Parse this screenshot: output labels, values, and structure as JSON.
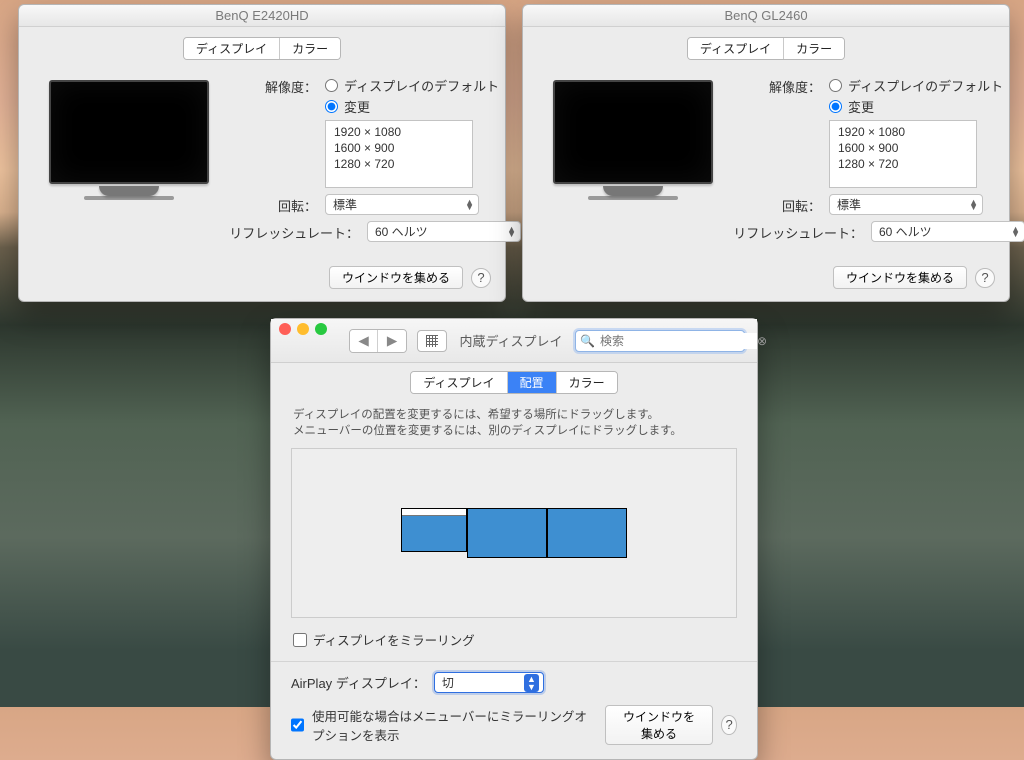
{
  "tabs": {
    "display": "ディスプレイ",
    "arrangement": "配置",
    "color": "カラー"
  },
  "labels": {
    "resolution": "解像度：",
    "default": "ディスプレイのデフォルト",
    "scaled": "変更",
    "rotation": "回転：",
    "rotation_value": "標準",
    "refresh": "リフレッシュレート：",
    "refresh_value": "60 ヘルツ",
    "gather": "ウインドウを集める"
  },
  "resolutions": [
    "1920 × 1080",
    "1600 × 900",
    "1280 × 720"
  ],
  "win1": {
    "title": "BenQ E2420HD"
  },
  "win2": {
    "title": "BenQ GL2460"
  },
  "win3": {
    "title": "内蔵ディスプレイ",
    "help1": "ディスプレイの配置を変更するには、希望する場所にドラッグします。",
    "help2": "メニューバーの位置を変更するには、別のディスプレイにドラッグします。",
    "mirror": "ディスプレイをミラーリング",
    "airplay_label": "AirPlay ディスプレイ：",
    "airplay_value": "切",
    "menubar_opt": "使用可能な場合はメニューバーにミラーリングオプションを表示",
    "search_placeholder": "検索"
  }
}
